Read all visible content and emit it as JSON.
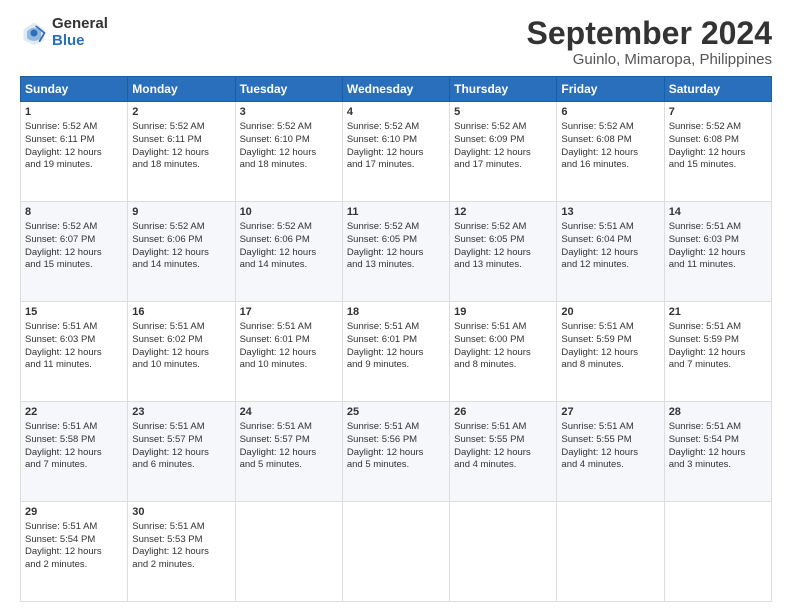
{
  "logo": {
    "general": "General",
    "blue": "Blue"
  },
  "title": "September 2024",
  "location": "Guinlo, Mimaropa, Philippines",
  "headers": [
    "Sunday",
    "Monday",
    "Tuesday",
    "Wednesday",
    "Thursday",
    "Friday",
    "Saturday"
  ],
  "weeks": [
    [
      {
        "day": "1",
        "lines": [
          "Sunrise: 5:52 AM",
          "Sunset: 6:11 PM",
          "Daylight: 12 hours",
          "and 19 minutes."
        ]
      },
      {
        "day": "2",
        "lines": [
          "Sunrise: 5:52 AM",
          "Sunset: 6:11 PM",
          "Daylight: 12 hours",
          "and 18 minutes."
        ]
      },
      {
        "day": "3",
        "lines": [
          "Sunrise: 5:52 AM",
          "Sunset: 6:10 PM",
          "Daylight: 12 hours",
          "and 18 minutes."
        ]
      },
      {
        "day": "4",
        "lines": [
          "Sunrise: 5:52 AM",
          "Sunset: 6:10 PM",
          "Daylight: 12 hours",
          "and 17 minutes."
        ]
      },
      {
        "day": "5",
        "lines": [
          "Sunrise: 5:52 AM",
          "Sunset: 6:09 PM",
          "Daylight: 12 hours",
          "and 17 minutes."
        ]
      },
      {
        "day": "6",
        "lines": [
          "Sunrise: 5:52 AM",
          "Sunset: 6:08 PM",
          "Daylight: 12 hours",
          "and 16 minutes."
        ]
      },
      {
        "day": "7",
        "lines": [
          "Sunrise: 5:52 AM",
          "Sunset: 6:08 PM",
          "Daylight: 12 hours",
          "and 15 minutes."
        ]
      }
    ],
    [
      {
        "day": "8",
        "lines": [
          "Sunrise: 5:52 AM",
          "Sunset: 6:07 PM",
          "Daylight: 12 hours",
          "and 15 minutes."
        ]
      },
      {
        "day": "9",
        "lines": [
          "Sunrise: 5:52 AM",
          "Sunset: 6:06 PM",
          "Daylight: 12 hours",
          "and 14 minutes."
        ]
      },
      {
        "day": "10",
        "lines": [
          "Sunrise: 5:52 AM",
          "Sunset: 6:06 PM",
          "Daylight: 12 hours",
          "and 14 minutes."
        ]
      },
      {
        "day": "11",
        "lines": [
          "Sunrise: 5:52 AM",
          "Sunset: 6:05 PM",
          "Daylight: 12 hours",
          "and 13 minutes."
        ]
      },
      {
        "day": "12",
        "lines": [
          "Sunrise: 5:52 AM",
          "Sunset: 6:05 PM",
          "Daylight: 12 hours",
          "and 13 minutes."
        ]
      },
      {
        "day": "13",
        "lines": [
          "Sunrise: 5:51 AM",
          "Sunset: 6:04 PM",
          "Daylight: 12 hours",
          "and 12 minutes."
        ]
      },
      {
        "day": "14",
        "lines": [
          "Sunrise: 5:51 AM",
          "Sunset: 6:03 PM",
          "Daylight: 12 hours",
          "and 11 minutes."
        ]
      }
    ],
    [
      {
        "day": "15",
        "lines": [
          "Sunrise: 5:51 AM",
          "Sunset: 6:03 PM",
          "Daylight: 12 hours",
          "and 11 minutes."
        ]
      },
      {
        "day": "16",
        "lines": [
          "Sunrise: 5:51 AM",
          "Sunset: 6:02 PM",
          "Daylight: 12 hours",
          "and 10 minutes."
        ]
      },
      {
        "day": "17",
        "lines": [
          "Sunrise: 5:51 AM",
          "Sunset: 6:01 PM",
          "Daylight: 12 hours",
          "and 10 minutes."
        ]
      },
      {
        "day": "18",
        "lines": [
          "Sunrise: 5:51 AM",
          "Sunset: 6:01 PM",
          "Daylight: 12 hours",
          "and 9 minutes."
        ]
      },
      {
        "day": "19",
        "lines": [
          "Sunrise: 5:51 AM",
          "Sunset: 6:00 PM",
          "Daylight: 12 hours",
          "and 8 minutes."
        ]
      },
      {
        "day": "20",
        "lines": [
          "Sunrise: 5:51 AM",
          "Sunset: 5:59 PM",
          "Daylight: 12 hours",
          "and 8 minutes."
        ]
      },
      {
        "day": "21",
        "lines": [
          "Sunrise: 5:51 AM",
          "Sunset: 5:59 PM",
          "Daylight: 12 hours",
          "and 7 minutes."
        ]
      }
    ],
    [
      {
        "day": "22",
        "lines": [
          "Sunrise: 5:51 AM",
          "Sunset: 5:58 PM",
          "Daylight: 12 hours",
          "and 7 minutes."
        ]
      },
      {
        "day": "23",
        "lines": [
          "Sunrise: 5:51 AM",
          "Sunset: 5:57 PM",
          "Daylight: 12 hours",
          "and 6 minutes."
        ]
      },
      {
        "day": "24",
        "lines": [
          "Sunrise: 5:51 AM",
          "Sunset: 5:57 PM",
          "Daylight: 12 hours",
          "and 5 minutes."
        ]
      },
      {
        "day": "25",
        "lines": [
          "Sunrise: 5:51 AM",
          "Sunset: 5:56 PM",
          "Daylight: 12 hours",
          "and 5 minutes."
        ]
      },
      {
        "day": "26",
        "lines": [
          "Sunrise: 5:51 AM",
          "Sunset: 5:55 PM",
          "Daylight: 12 hours",
          "and 4 minutes."
        ]
      },
      {
        "day": "27",
        "lines": [
          "Sunrise: 5:51 AM",
          "Sunset: 5:55 PM",
          "Daylight: 12 hours",
          "and 4 minutes."
        ]
      },
      {
        "day": "28",
        "lines": [
          "Sunrise: 5:51 AM",
          "Sunset: 5:54 PM",
          "Daylight: 12 hours",
          "and 3 minutes."
        ]
      }
    ],
    [
      {
        "day": "29",
        "lines": [
          "Sunrise: 5:51 AM",
          "Sunset: 5:54 PM",
          "Daylight: 12 hours",
          "and 2 minutes."
        ]
      },
      {
        "day": "30",
        "lines": [
          "Sunrise: 5:51 AM",
          "Sunset: 5:53 PM",
          "Daylight: 12 hours",
          "and 2 minutes."
        ]
      },
      {
        "day": "",
        "lines": []
      },
      {
        "day": "",
        "lines": []
      },
      {
        "day": "",
        "lines": []
      },
      {
        "day": "",
        "lines": []
      },
      {
        "day": "",
        "lines": []
      }
    ]
  ]
}
